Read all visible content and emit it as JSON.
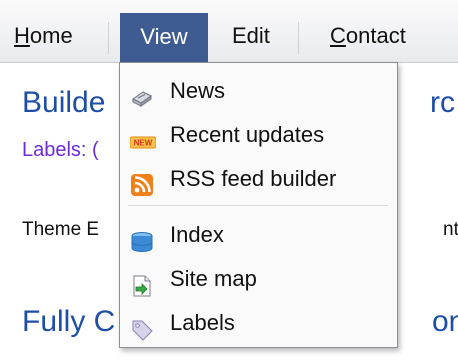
{
  "menubar": {
    "items": [
      {
        "label_underlined": "H",
        "label_rest": "ome"
      },
      {
        "label": "View"
      },
      {
        "label": "Edit"
      },
      {
        "label_underlined": "C",
        "label_rest": "ontact"
      }
    ]
  },
  "page": {
    "post_title_1": "Builde",
    "post_title_1_tail": "rc",
    "labels": "Labels: (",
    "body": "Theme E",
    "body_tail": "ntec",
    "post_title_2": "Fully C",
    "post_title_2_tail": "on"
  },
  "dropdown": {
    "items": [
      {
        "label": "News",
        "icon": "news-icon"
      },
      {
        "label": "Recent updates",
        "icon": "new-badge-icon",
        "badge": "NEW"
      },
      {
        "label": "RSS feed builder",
        "icon": "rss-icon"
      },
      {
        "label": "Index",
        "icon": "index-icon"
      },
      {
        "label": "Site map",
        "icon": "sitemap-icon"
      },
      {
        "label": "Labels",
        "icon": "tag-icon"
      }
    ]
  },
  "colors": {
    "active_menu_bg": "#3e5b92",
    "link_blue": "#1e4ea6",
    "labels_purple": "#6b2bd6",
    "rss_orange": "#f0811a"
  }
}
